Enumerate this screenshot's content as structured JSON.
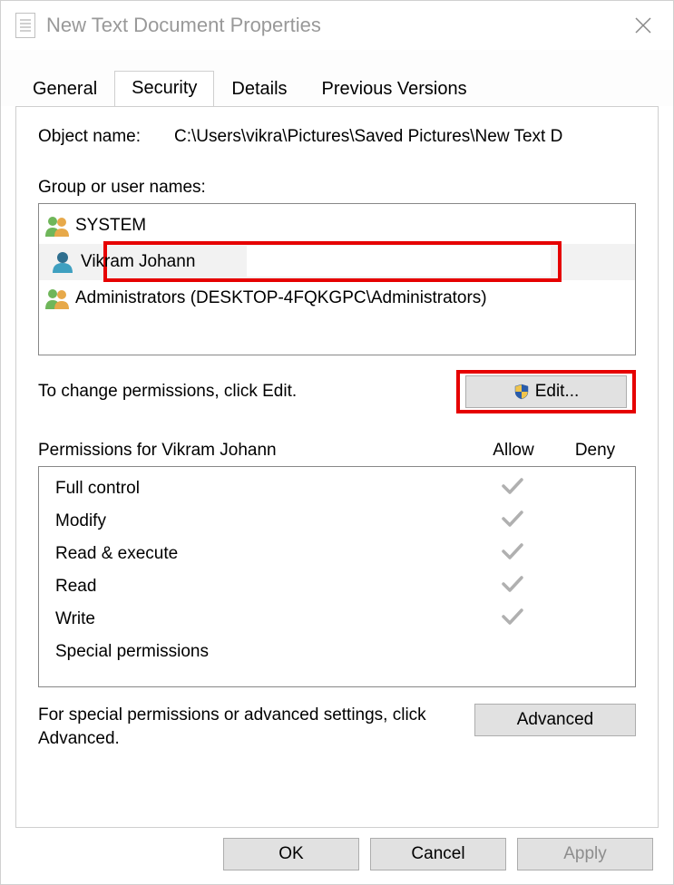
{
  "window": {
    "title": "New Text Document Properties"
  },
  "tabs": {
    "general": "General",
    "security": "Security",
    "details": "Details",
    "previous": "Previous Versions"
  },
  "object": {
    "label": "Object name:",
    "value": "C:\\Users\\vikra\\Pictures\\Saved Pictures\\New Text D"
  },
  "groups": {
    "label": "Group or user names:",
    "items": [
      {
        "name": "SYSTEM",
        "iconColors": [
          "#6fb65a",
          "#e7a94a"
        ]
      },
      {
        "name": "Vikram Johann",
        "iconColors": [
          "#2f6f8f",
          "#3fa0c0"
        ]
      },
      {
        "name": "Administrators (DESKTOP-4FQKGPC\\Administrators)",
        "iconColors": [
          "#6fb65a",
          "#e7a94a"
        ]
      }
    ]
  },
  "change": {
    "text": "To change permissions, click Edit.",
    "button": "Edit..."
  },
  "permissions": {
    "header_name": "Permissions for Vikram Johann",
    "header_allow": "Allow",
    "header_deny": "Deny",
    "rows": [
      {
        "name": "Full control",
        "allow": true,
        "deny": false
      },
      {
        "name": "Modify",
        "allow": true,
        "deny": false
      },
      {
        "name": "Read & execute",
        "allow": true,
        "deny": false
      },
      {
        "name": "Read",
        "allow": true,
        "deny": false
      },
      {
        "name": "Write",
        "allow": true,
        "deny": false
      },
      {
        "name": "Special permissions",
        "allow": false,
        "deny": false
      }
    ]
  },
  "advanced": {
    "text": "For special permissions or advanced settings, click Advanced.",
    "button": "Advanced"
  },
  "buttons": {
    "ok": "OK",
    "cancel": "Cancel",
    "apply": "Apply"
  }
}
